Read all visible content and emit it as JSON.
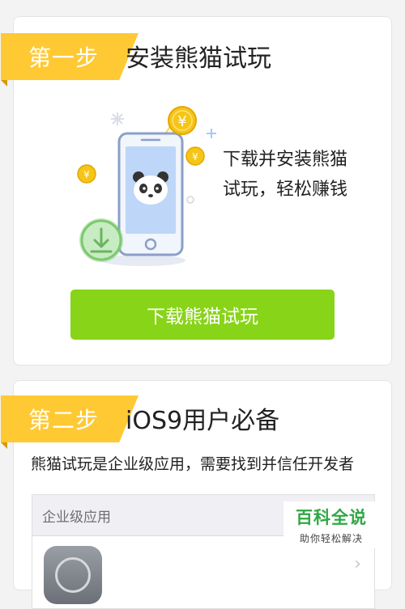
{
  "step1": {
    "badge": "第一步",
    "title": "安装熊猫试玩",
    "desc_line1": "下载并安装熊猫",
    "desc_line2": "试玩，轻松赚钱",
    "button_label": "下载熊猫试玩",
    "illustration": {
      "phone_icon": "phone-icon",
      "panda_icon": "panda-icon",
      "download_icon": "download-icon",
      "coin_icon": "yuan-coin-icon",
      "coin_symbol": "¥"
    }
  },
  "step2": {
    "badge": "第二步",
    "title": "iOS9用户必备",
    "desc": "熊猫试玩是企业级应用，需要找到并信任开发者",
    "panel_header": "企业级应用",
    "chevron": "›"
  },
  "watermark": {
    "title": "百科全说",
    "subtitle": "助你轻松解决"
  },
  "colors": {
    "ribbon": "#ffc933",
    "button": "#88d418",
    "coin": "#f5c518",
    "download_circle": "#7cc96f"
  }
}
